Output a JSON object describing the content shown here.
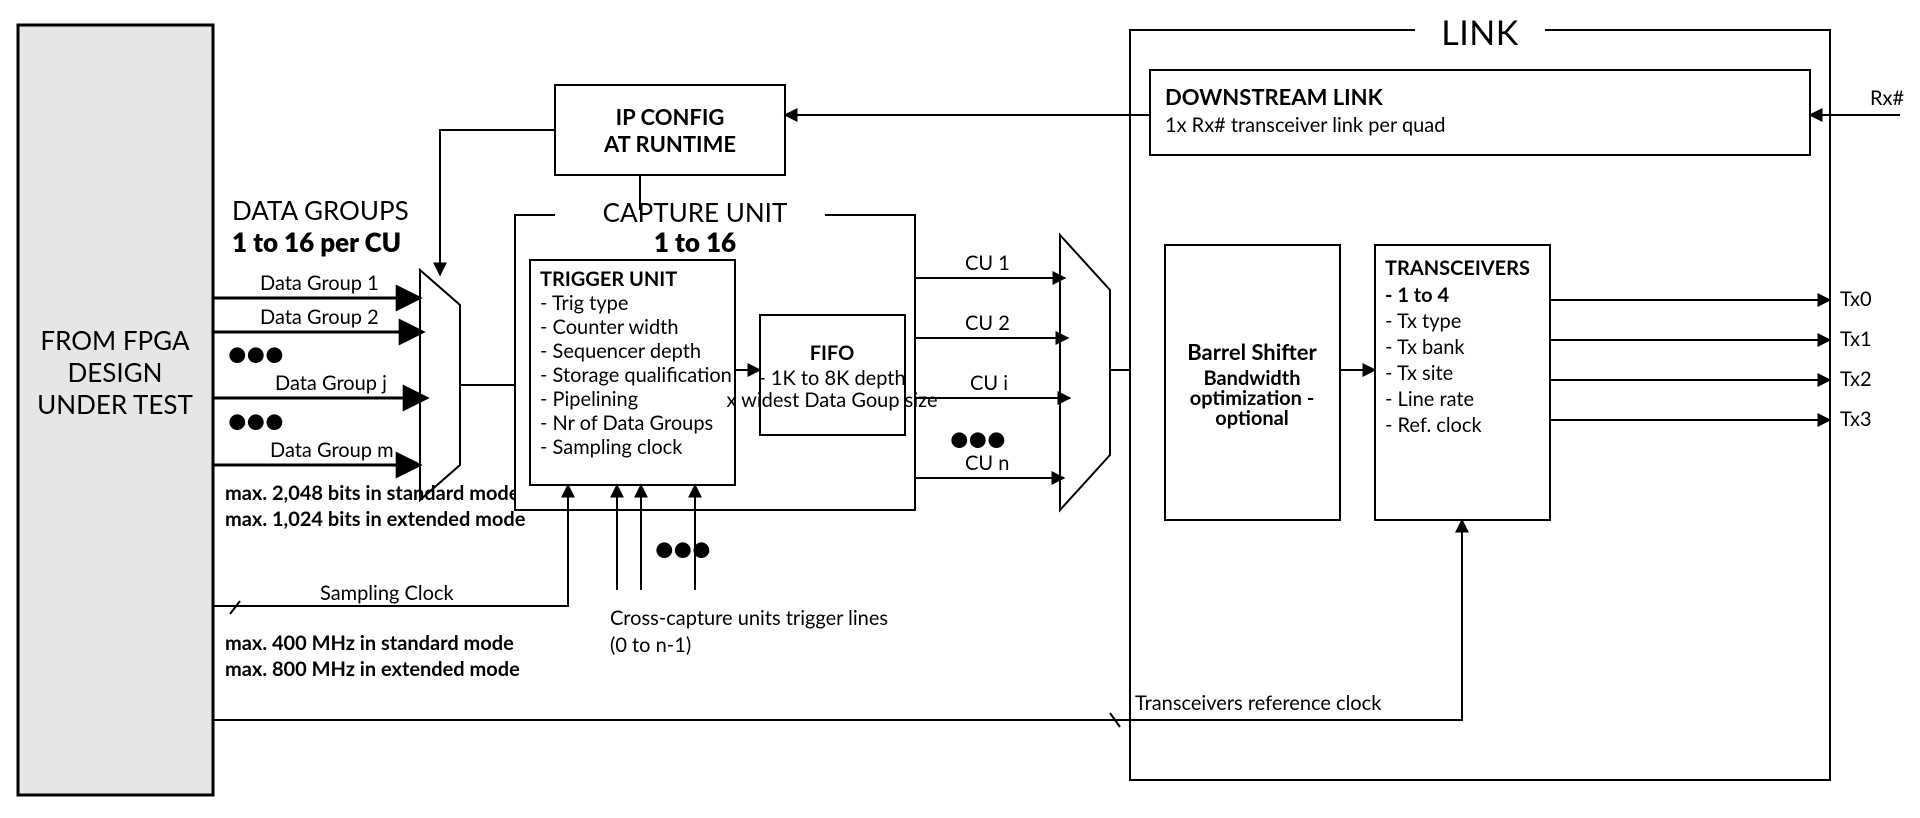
{
  "fpga_source": {
    "line1": "FROM FPGA",
    "line2": "DESIGN",
    "line3": "UNDER TEST"
  },
  "data_groups": {
    "title_line1": "DATA GROUPS",
    "title_line2": "1 to 16 per CU",
    "items": {
      "g1": "Data Group 1",
      "g2": "Data Group 2",
      "gj": "Data Group j",
      "gm": "Data Group m"
    },
    "ellipsis_top": "•••",
    "ellipsis_bottom": "•••",
    "max_line1": "max. 2,048 bits in standard mode",
    "max_line2": "max. 1,024 bits in extended mode"
  },
  "sampling_clock": {
    "label": "Sampling Clock",
    "max_line1": "max. 400 MHz in standard mode",
    "max_line2": "max. 800 MHz in extended mode"
  },
  "ip_config": {
    "line1": "IP CONFIG",
    "line2": "AT RUNTIME"
  },
  "capture_unit": {
    "title": "CAPTURE UNIT",
    "subtitle": "1 to 16",
    "trigger": {
      "title": "TRIGGER UNIT",
      "items": [
        "- Trig type",
        "- Counter width",
        "- Sequencer depth",
        "- Storage qualification",
        "- Pipelining",
        "- Nr of Data Groups",
        "- Sampling clock"
      ]
    },
    "fifo": {
      "title": "FIFO",
      "line1": "- 1K to 8K depth",
      "line2": "x widest Data Goup size"
    }
  },
  "cross_trigger": {
    "label_line1": "Cross-capture units trigger lines",
    "label_line2": "(0 to n-1)",
    "ellipsis": "•••"
  },
  "cu_outputs": {
    "cu1": "CU 1",
    "cu2": "CU 2",
    "cui": "CU i",
    "cun": "CU n",
    "ellipsis": "•••"
  },
  "link": {
    "title": "LINK",
    "downstream": {
      "title": "DOWNSTREAM LINK",
      "sub": "1x Rx# transceiver link per quad"
    },
    "barrel_shifter": {
      "title": "Barrel Shifter",
      "sub1": "Bandwidth",
      "sub2": "optimization -",
      "sub3": "optional"
    },
    "transceivers": {
      "title": "TRANSCEIVERS",
      "items": [
        "- 1 to 4",
        "- Tx type",
        "- Tx bank",
        "- Tx site",
        "- Line rate",
        "- Ref. clock"
      ]
    },
    "ref_clock_label": "Transceivers reference clock"
  },
  "io": {
    "rx": "Rx#",
    "tx": [
      "Tx0",
      "Tx1",
      "Tx2",
      "Tx3"
    ]
  }
}
